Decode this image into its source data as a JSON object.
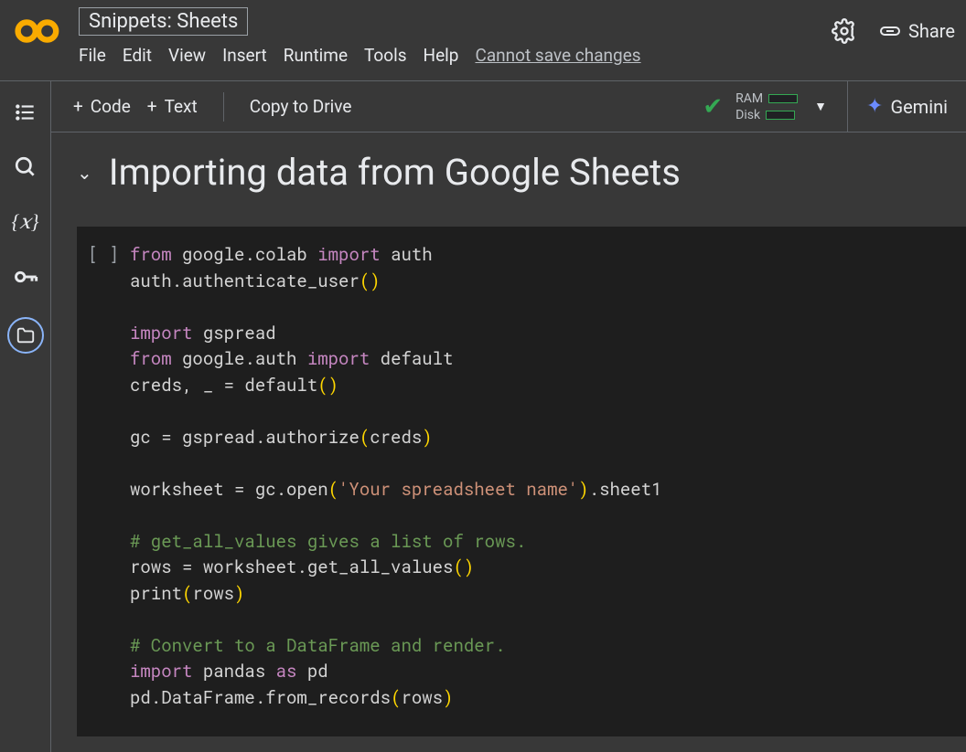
{
  "doc_title": "Snippets: Sheets",
  "menus": [
    "File",
    "Edit",
    "View",
    "Insert",
    "Runtime",
    "Tools",
    "Help"
  ],
  "save_status": "Cannot save changes",
  "share_label": "Share",
  "toolbar": {
    "code_label": "Code",
    "text_label": "Text",
    "copy_label": "Copy to Drive",
    "ram_label": "RAM",
    "disk_label": "Disk",
    "gemini_label": "Gemini"
  },
  "section_title": "Importing data from Google Sheets",
  "cell_prompt": "[ ]",
  "code": {
    "l1a": "from",
    "l1b": " google.colab ",
    "l1c": "import",
    "l1d": " auth",
    "l2a": "auth.authenticate_user",
    "l2p1": "(",
    "l2p2": ")",
    "l3": "",
    "l4a": "import",
    "l4b": " gspread",
    "l5a": "from",
    "l5b": " google.auth ",
    "l5c": "import",
    "l5d": " default",
    "l6a": "creds, _ = default",
    "l6p1": "(",
    "l6p2": ")",
    "l7": "",
    "l8a": "gc = gspread.authorize",
    "l8p1": "(",
    "l8b": "creds",
    "l8p2": ")",
    "l9": "",
    "l10a": "worksheet = gc.open",
    "l10p1": "(",
    "l10s": "'Your spreadsheet name'",
    "l10p2": ")",
    "l10b": ".sheet1",
    "l11": "",
    "l12": "# get_all_values gives a list of rows.",
    "l13a": "rows = worksheet.get_all_values",
    "l13p1": "(",
    "l13p2": ")",
    "l14a": "print",
    "l14p1": "(",
    "l14b": "rows",
    "l14p2": ")",
    "l15": "",
    "l16": "# Convert to a DataFrame and render.",
    "l17a": "import",
    "l17b": " pandas ",
    "l17c": "as",
    "l17d": " pd",
    "l18a": "pd.DataFrame.from_records",
    "l18p1": "(",
    "l18b": "rows",
    "l18p2": ")"
  }
}
